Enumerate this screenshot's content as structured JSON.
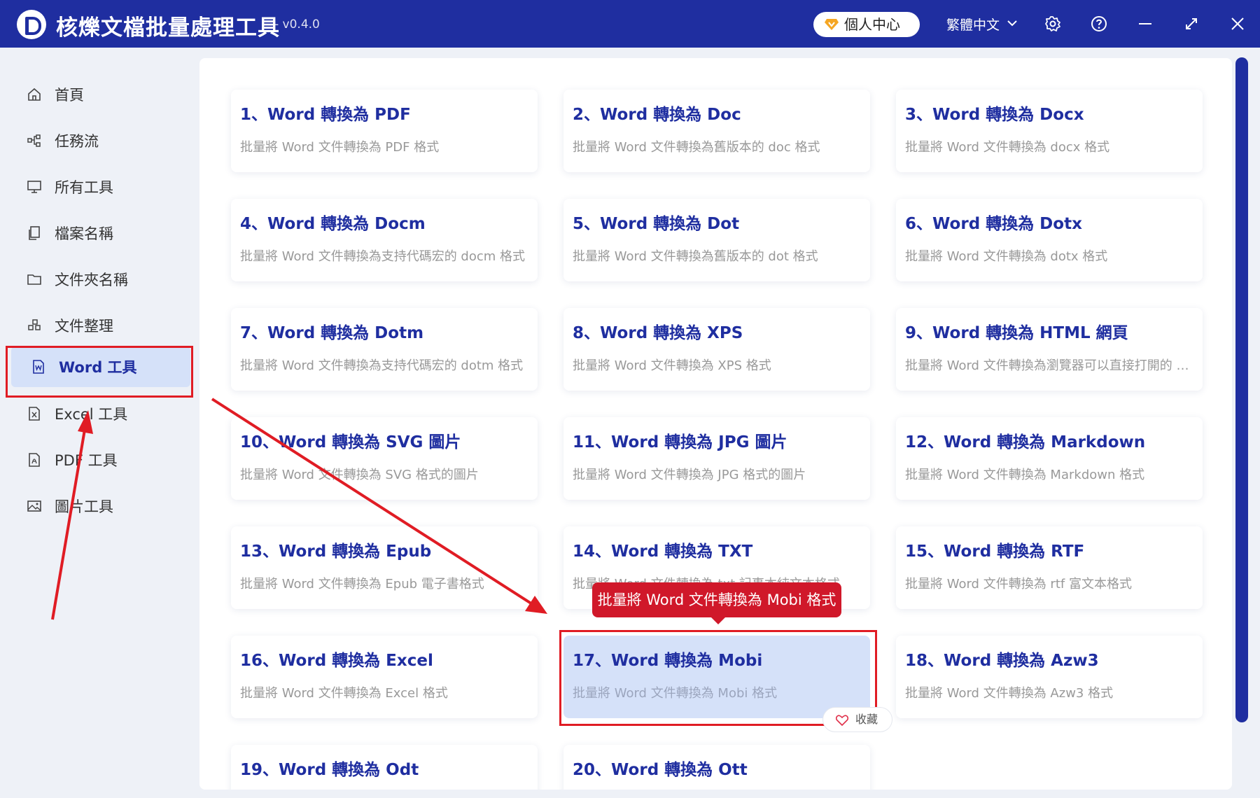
{
  "app": {
    "title": "核爍文檔批量處理工具",
    "version": "- v0.4.0"
  },
  "header": {
    "user_center": "個人中心",
    "language": "繁體中文"
  },
  "sidebar": {
    "items": [
      {
        "label": "首頁",
        "icon": "home-icon"
      },
      {
        "label": "任務流",
        "icon": "workflow-icon"
      },
      {
        "label": "所有工具",
        "icon": "monitor-icon"
      },
      {
        "label": "檔案名稱",
        "icon": "file-copy-icon"
      },
      {
        "label": "文件夾名稱",
        "icon": "folder-icon"
      },
      {
        "label": "文件整理",
        "icon": "organize-icon"
      },
      {
        "label": "Word 工具",
        "icon": "word-doc-icon"
      },
      {
        "label": "Excel 工具",
        "icon": "excel-doc-icon"
      },
      {
        "label": "PDF 工具",
        "icon": "pdf-doc-icon"
      },
      {
        "label": "圖片工具",
        "icon": "image-icon"
      }
    ],
    "active_index": 6
  },
  "tools": [
    {
      "title": "1、Word 轉換為 PDF",
      "desc": "批量將 Word 文件轉換為 PDF 格式"
    },
    {
      "title": "2、Word 轉換為 Doc",
      "desc": "批量將 Word 文件轉換為舊版本的 doc 格式"
    },
    {
      "title": "3、Word 轉換為 Docx",
      "desc": "批量將 Word 文件轉換為 docx 格式"
    },
    {
      "title": "4、Word 轉換為 Docm",
      "desc": "批量將 Word 文件轉換為支持代碼宏的 docm 格式"
    },
    {
      "title": "5、Word 轉換為 Dot",
      "desc": "批量將 Word 文件轉換為舊版本的 dot 格式"
    },
    {
      "title": "6、Word 轉換為 Dotx",
      "desc": "批量將 Word 文件轉換為 dotx 格式"
    },
    {
      "title": "7、Word 轉換為 Dotm",
      "desc": "批量將 Word 文件轉換為支持代碼宏的 dotm 格式"
    },
    {
      "title": "8、Word 轉換為 XPS",
      "desc": "批量將 Word 文件轉換為 XPS 格式"
    },
    {
      "title": "9、Word 轉換為 HTML 網頁",
      "desc": "批量將 Word 文件轉換為瀏覽器可以直接打開的 H..."
    },
    {
      "title": "10、Word 轉換為 SVG 圖片",
      "desc": "批量將 Word 文件轉換為 SVG 格式的圖片"
    },
    {
      "title": "11、Word 轉換為 JPG 圖片",
      "desc": "批量將 Word 文件轉換為 JPG 格式的圖片"
    },
    {
      "title": "12、Word 轉換為 Markdown",
      "desc": "批量將 Word 文件轉換為 Markdown 格式"
    },
    {
      "title": "13、Word 轉換為 Epub",
      "desc": "批量將 Word 文件轉換為 Epub 電子書格式"
    },
    {
      "title": "14、Word 轉換為 TXT",
      "desc": "批量將 Word 文件轉換為 txt 記事本純文本格式"
    },
    {
      "title": "15、Word 轉換為 RTF",
      "desc": "批量將 Word 文件轉換為 rtf 富文本格式"
    },
    {
      "title": "16、Word 轉換為 Excel",
      "desc": "批量將 Word 文件轉換為 Excel 格式"
    },
    {
      "title": "17、Word 轉換為 Mobi",
      "desc": "批量將 Word 文件轉換為 Mobi 格式"
    },
    {
      "title": "18、Word 轉換為 Azw3",
      "desc": "批量將 Word 文件轉換為 Azw3 格式"
    },
    {
      "title": "19、Word 轉換為 Odt",
      "desc": ""
    },
    {
      "title": "20、Word 轉換為 Ott",
      "desc": ""
    }
  ],
  "selected_tool_index": 16,
  "tooltip": "批量將 Word 文件轉換為 Mobi 格式",
  "favorite_label": "收藏",
  "colors": {
    "brand": "#1f2ea0",
    "highlight": "#e01c24",
    "selected_bg": "#d5e1f9"
  }
}
